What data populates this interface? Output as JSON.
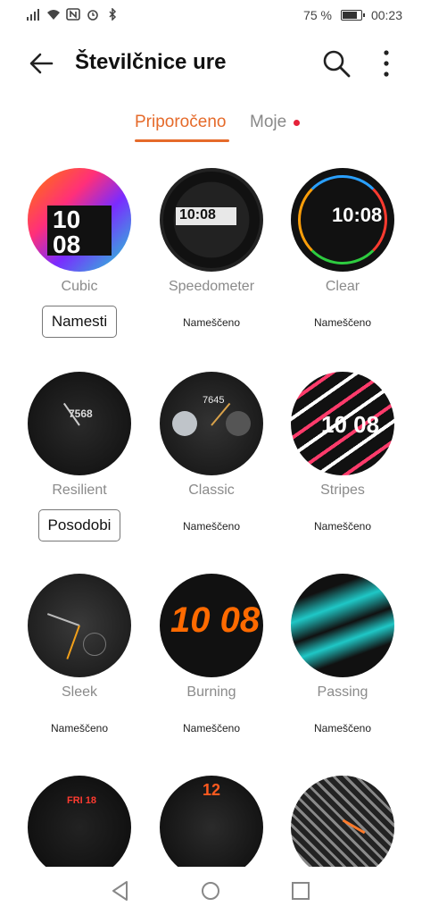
{
  "status_bar": {
    "battery": "75 %",
    "time": "00:23"
  },
  "header": {
    "title": "Številčnice ure"
  },
  "tabs": [
    {
      "label": "Priporočeno"
    },
    {
      "label": "Moje"
    }
  ],
  "faces": [
    {
      "name": "Cubic",
      "status": "",
      "button": "Namesti",
      "time": "10\n08",
      "accent": "#ff4fa3"
    },
    {
      "name": "Speedometer",
      "status": "Nameščeno",
      "button": "",
      "time": "10:08",
      "accent": "#f5c400"
    },
    {
      "name": "Clear",
      "status": "Nameščeno",
      "button": "",
      "time": "10:08",
      "accent": "#2aa0ff"
    },
    {
      "name": "Resilient",
      "status": "",
      "button": "Posodobi",
      "time": "7568",
      "accent": "#cccccc"
    },
    {
      "name": "Classic",
      "status": "Nameščeno",
      "button": "",
      "time": "7645",
      "accent": "#d9a24a"
    },
    {
      "name": "Stripes",
      "status": "Nameščeno",
      "button": "",
      "time": "10 08",
      "accent": "#ff3b6b"
    },
    {
      "name": "Sleek",
      "status": "Nameščeno",
      "button": "",
      "time": "",
      "accent": "#f2a01a"
    },
    {
      "name": "Burning",
      "status": "Nameščeno",
      "button": "",
      "time": "10 08",
      "accent": "#ff6a00"
    },
    {
      "name": "Passing",
      "status": "Nameščeno",
      "button": "",
      "time": "",
      "accent": "#1fc7c6"
    },
    {
      "name": "",
      "status": "",
      "button": "",
      "time": "FRI 18",
      "accent": "#ffffff"
    },
    {
      "name": "",
      "status": "",
      "button": "",
      "time": "12",
      "accent": "#ff5a1f"
    },
    {
      "name": "",
      "status": "",
      "button": "",
      "time": "",
      "accent": "#ff7a2a"
    }
  ],
  "colors": {
    "accent": "#e56a2a",
    "badge": "#e5223a"
  }
}
